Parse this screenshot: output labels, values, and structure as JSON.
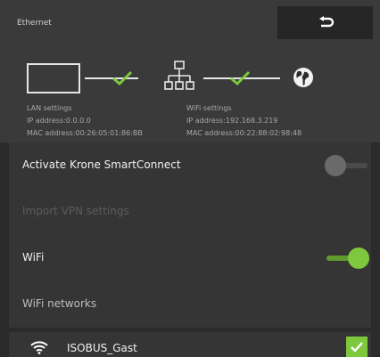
{
  "header": {
    "title": "Ethernet",
    "back_icon": "return-arrow-icon"
  },
  "diagram": {
    "lan": {
      "title": "LAN settings",
      "ip_line": "IP address:0.0.0.0",
      "mac_line": "MAC address:00:26:05:01:86:BB"
    },
    "wifi": {
      "title": "WiFi settings",
      "ip_line": "IP address:192.168.3.219",
      "mac_line": "MAC address:00:22:88:02:98:48"
    },
    "status_color": "#7ec83e"
  },
  "settings": {
    "smartconnect": {
      "label": "Activate Krone SmartConnect",
      "state": "off"
    },
    "vpn": {
      "label": "Import VPN settings",
      "disabled": true
    },
    "wifi": {
      "label": "WiFi",
      "state": "on"
    },
    "networks_heading": "WiFi networks"
  },
  "networks": [
    {
      "ssid": "ISOBUS_Gast",
      "icon": "wifi-signal-icon",
      "selected": true
    }
  ],
  "colors": {
    "accent_green": "#7ec83e",
    "header_bg": "#3a3a3a",
    "row_bg": "#353535"
  }
}
